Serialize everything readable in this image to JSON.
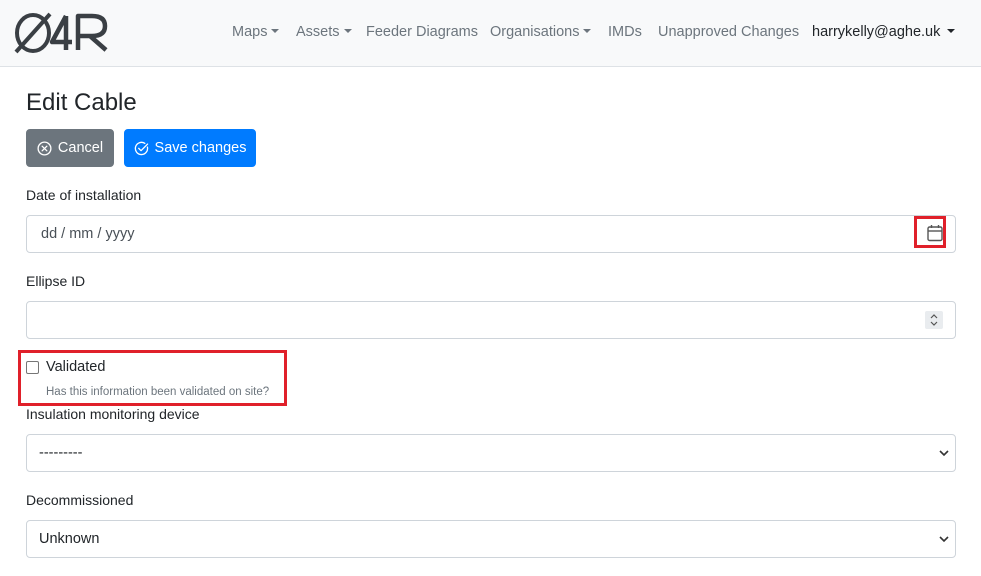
{
  "brand": {
    "logo_text": "O4R"
  },
  "nav": {
    "items": [
      {
        "label": "Maps",
        "dropdown": true
      },
      {
        "label": "Assets",
        "dropdown": true
      },
      {
        "label": "Feeder Diagrams",
        "dropdown": false
      },
      {
        "label": "Organisations",
        "dropdown": true
      },
      {
        "label": "IMDs",
        "dropdown": false
      },
      {
        "label": "Unapproved Changes",
        "dropdown": false
      }
    ],
    "user": "harrykelly@aghe.uk"
  },
  "page": {
    "title": "Edit Cable",
    "cancel_label": "Cancel",
    "save_label": "Save changes"
  },
  "form": {
    "date": {
      "label": "Date of installation",
      "placeholder": "dd / mm / yyyy"
    },
    "ellipse": {
      "label": "Ellipse ID",
      "value": ""
    },
    "validated": {
      "label": "Validated",
      "checked": false,
      "help": "Has this information been validated on site?"
    },
    "imd": {
      "label": "Insulation monitoring device",
      "selected": "---------"
    },
    "decommissioned": {
      "label": "Decommissioned",
      "selected": "Unknown"
    }
  },
  "colors": {
    "primary": "#007bff",
    "secondary": "#6c757d",
    "highlight": "#e0202a",
    "navbar_bg": "#f8f9fa"
  }
}
